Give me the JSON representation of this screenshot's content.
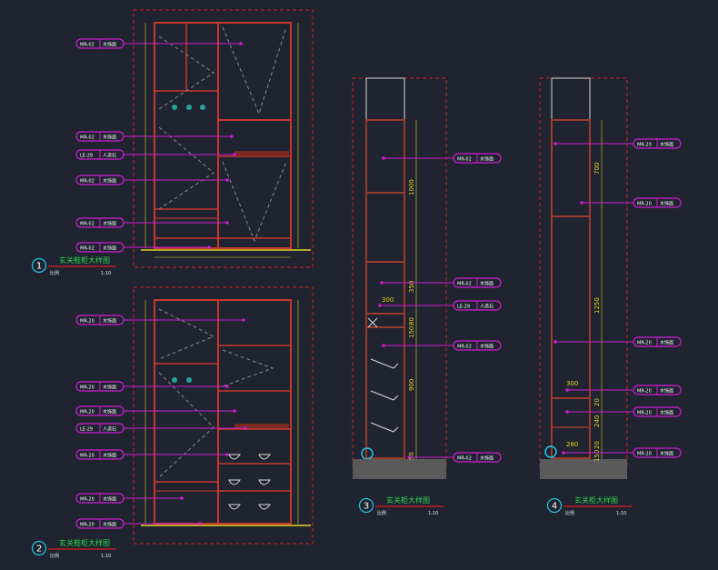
{
  "colors": {
    "background": "#1f2430",
    "frame_red": "#c8372d",
    "dash_red": "#d81f1f",
    "leader_magenta": "#d21cd2",
    "title_green": "#2fd64b",
    "dim_yellow": "#e6d21e",
    "circle_cyan": "#21c7e8",
    "cabinet_line": "#9a3a2a",
    "cabinet_white": "#d8d8d8"
  },
  "views": [
    {
      "number": "1",
      "title": "玄关鞋柜大样图",
      "scale_label": "比例",
      "scale_value": "1:10",
      "tags": [
        {
          "code": "MR-02",
          "label": "木饰面"
        },
        {
          "code": "MR-02",
          "label": "木饰面"
        },
        {
          "code": "LE-29",
          "label": "人造石"
        },
        {
          "code": "MR-02",
          "label": "木饰面"
        },
        {
          "code": "MR-02",
          "label": "木饰面"
        },
        {
          "code": "MR-02",
          "label": "木饰面"
        }
      ]
    },
    {
      "number": "2",
      "title": "玄关鞋柜大样图",
      "scale_label": "比例",
      "scale_value": "1:10",
      "tags": [
        {
          "code": "MR-20",
          "label": "木饰面"
        },
        {
          "code": "MR-20",
          "label": "木饰面"
        },
        {
          "code": "MR-20",
          "label": "木饰面"
        },
        {
          "code": "LE-29",
          "label": "人造石"
        },
        {
          "code": "MR-20",
          "label": "木饰面"
        },
        {
          "code": "MR-20",
          "label": "木饰面"
        },
        {
          "code": "MR-20",
          "label": "木饰面"
        }
      ]
    },
    {
      "number": "3",
      "title": "玄关柜大样图",
      "scale_label": "比例",
      "scale_value": "1:10",
      "tags": [
        {
          "code": "MR-02",
          "label": "木饰面"
        },
        {
          "code": "MR-02",
          "label": "木饰面"
        },
        {
          "code": "LE-29",
          "label": "人造石"
        },
        {
          "code": "MR-02",
          "label": "木饰面"
        },
        {
          "code": "MR-02",
          "label": "木饰面"
        }
      ],
      "dims": [
        "1000",
        "350",
        "300",
        "80",
        "150",
        "900",
        "50"
      ]
    },
    {
      "number": "4",
      "title": "玄关柜大样图",
      "scale_label": "比例",
      "scale_value": "1:10",
      "tags": [
        {
          "code": "MR-20",
          "label": "木饰面"
        },
        {
          "code": "MR-20",
          "label": "木饰面"
        },
        {
          "code": "MR-20",
          "label": "木饰面"
        },
        {
          "code": "MR-20",
          "label": "木饰面"
        },
        {
          "code": "MR-20",
          "label": "木饰面"
        },
        {
          "code": "MR-20",
          "label": "木饰面"
        }
      ],
      "dims": [
        "700",
        "1250",
        "300",
        "20",
        "240",
        "260",
        "20",
        "150"
      ]
    }
  ]
}
